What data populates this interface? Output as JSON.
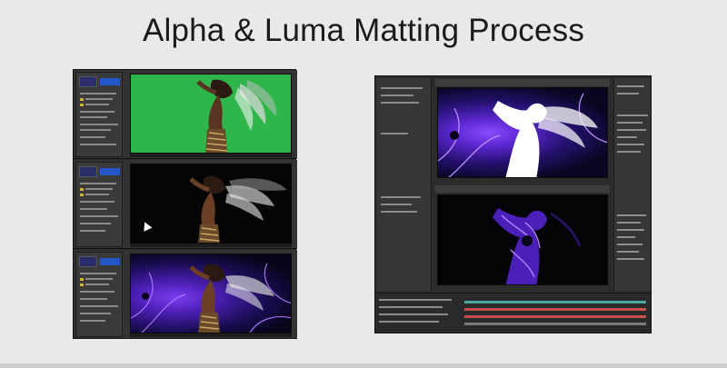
{
  "slide": {
    "title": "Alpha & Luma Matting Process"
  },
  "colors": {
    "background": "#e9e9e9",
    "greenscreen": "#2fb64a",
    "matte_purple": "#6a2fe0",
    "ae_panel": "#333333",
    "timeline_red": "#c94f4f",
    "timeline_teal": "#4aa9a0"
  },
  "left_screenshot": {
    "rows": [
      {
        "viewer": "green-screen-footage"
      },
      {
        "viewer": "keyed-on-black"
      },
      {
        "viewer": "composited-over-purple-fractal"
      }
    ]
  },
  "right_screenshot": {
    "comps": [
      {
        "viewer": "luma-matte-white-silhouette"
      },
      {
        "viewer": "fractal-through-matte"
      }
    ]
  }
}
